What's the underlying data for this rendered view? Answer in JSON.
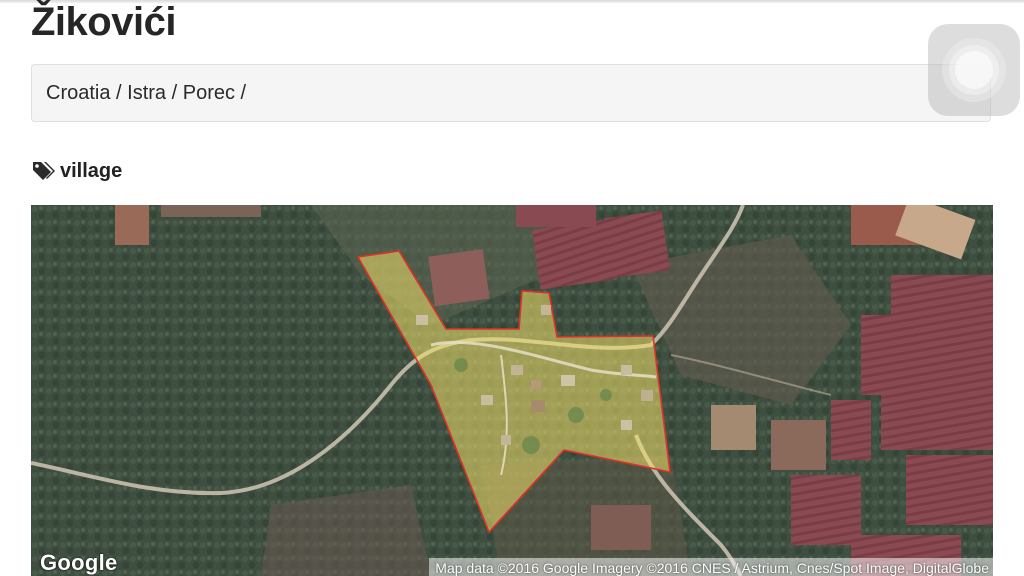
{
  "place": {
    "title": "Žikovići"
  },
  "breadcrumb": {
    "items": [
      "Croatia",
      "Istra",
      "Porec"
    ],
    "separator": " / "
  },
  "tags": [
    {
      "label": "village",
      "icon": "tags-icon"
    }
  ],
  "map": {
    "provider_logo": "Google",
    "attribution": "Map data ©2016 Google  Imagery ©2016 CNES / Astrium, Cnes/Spot Image, DigitalGlobe",
    "overlay_fill_color": "#f2e06a",
    "overlay_stroke_color": "#e0302a"
  },
  "assistive_touch": {
    "icon": "assistive-touch-icon"
  }
}
